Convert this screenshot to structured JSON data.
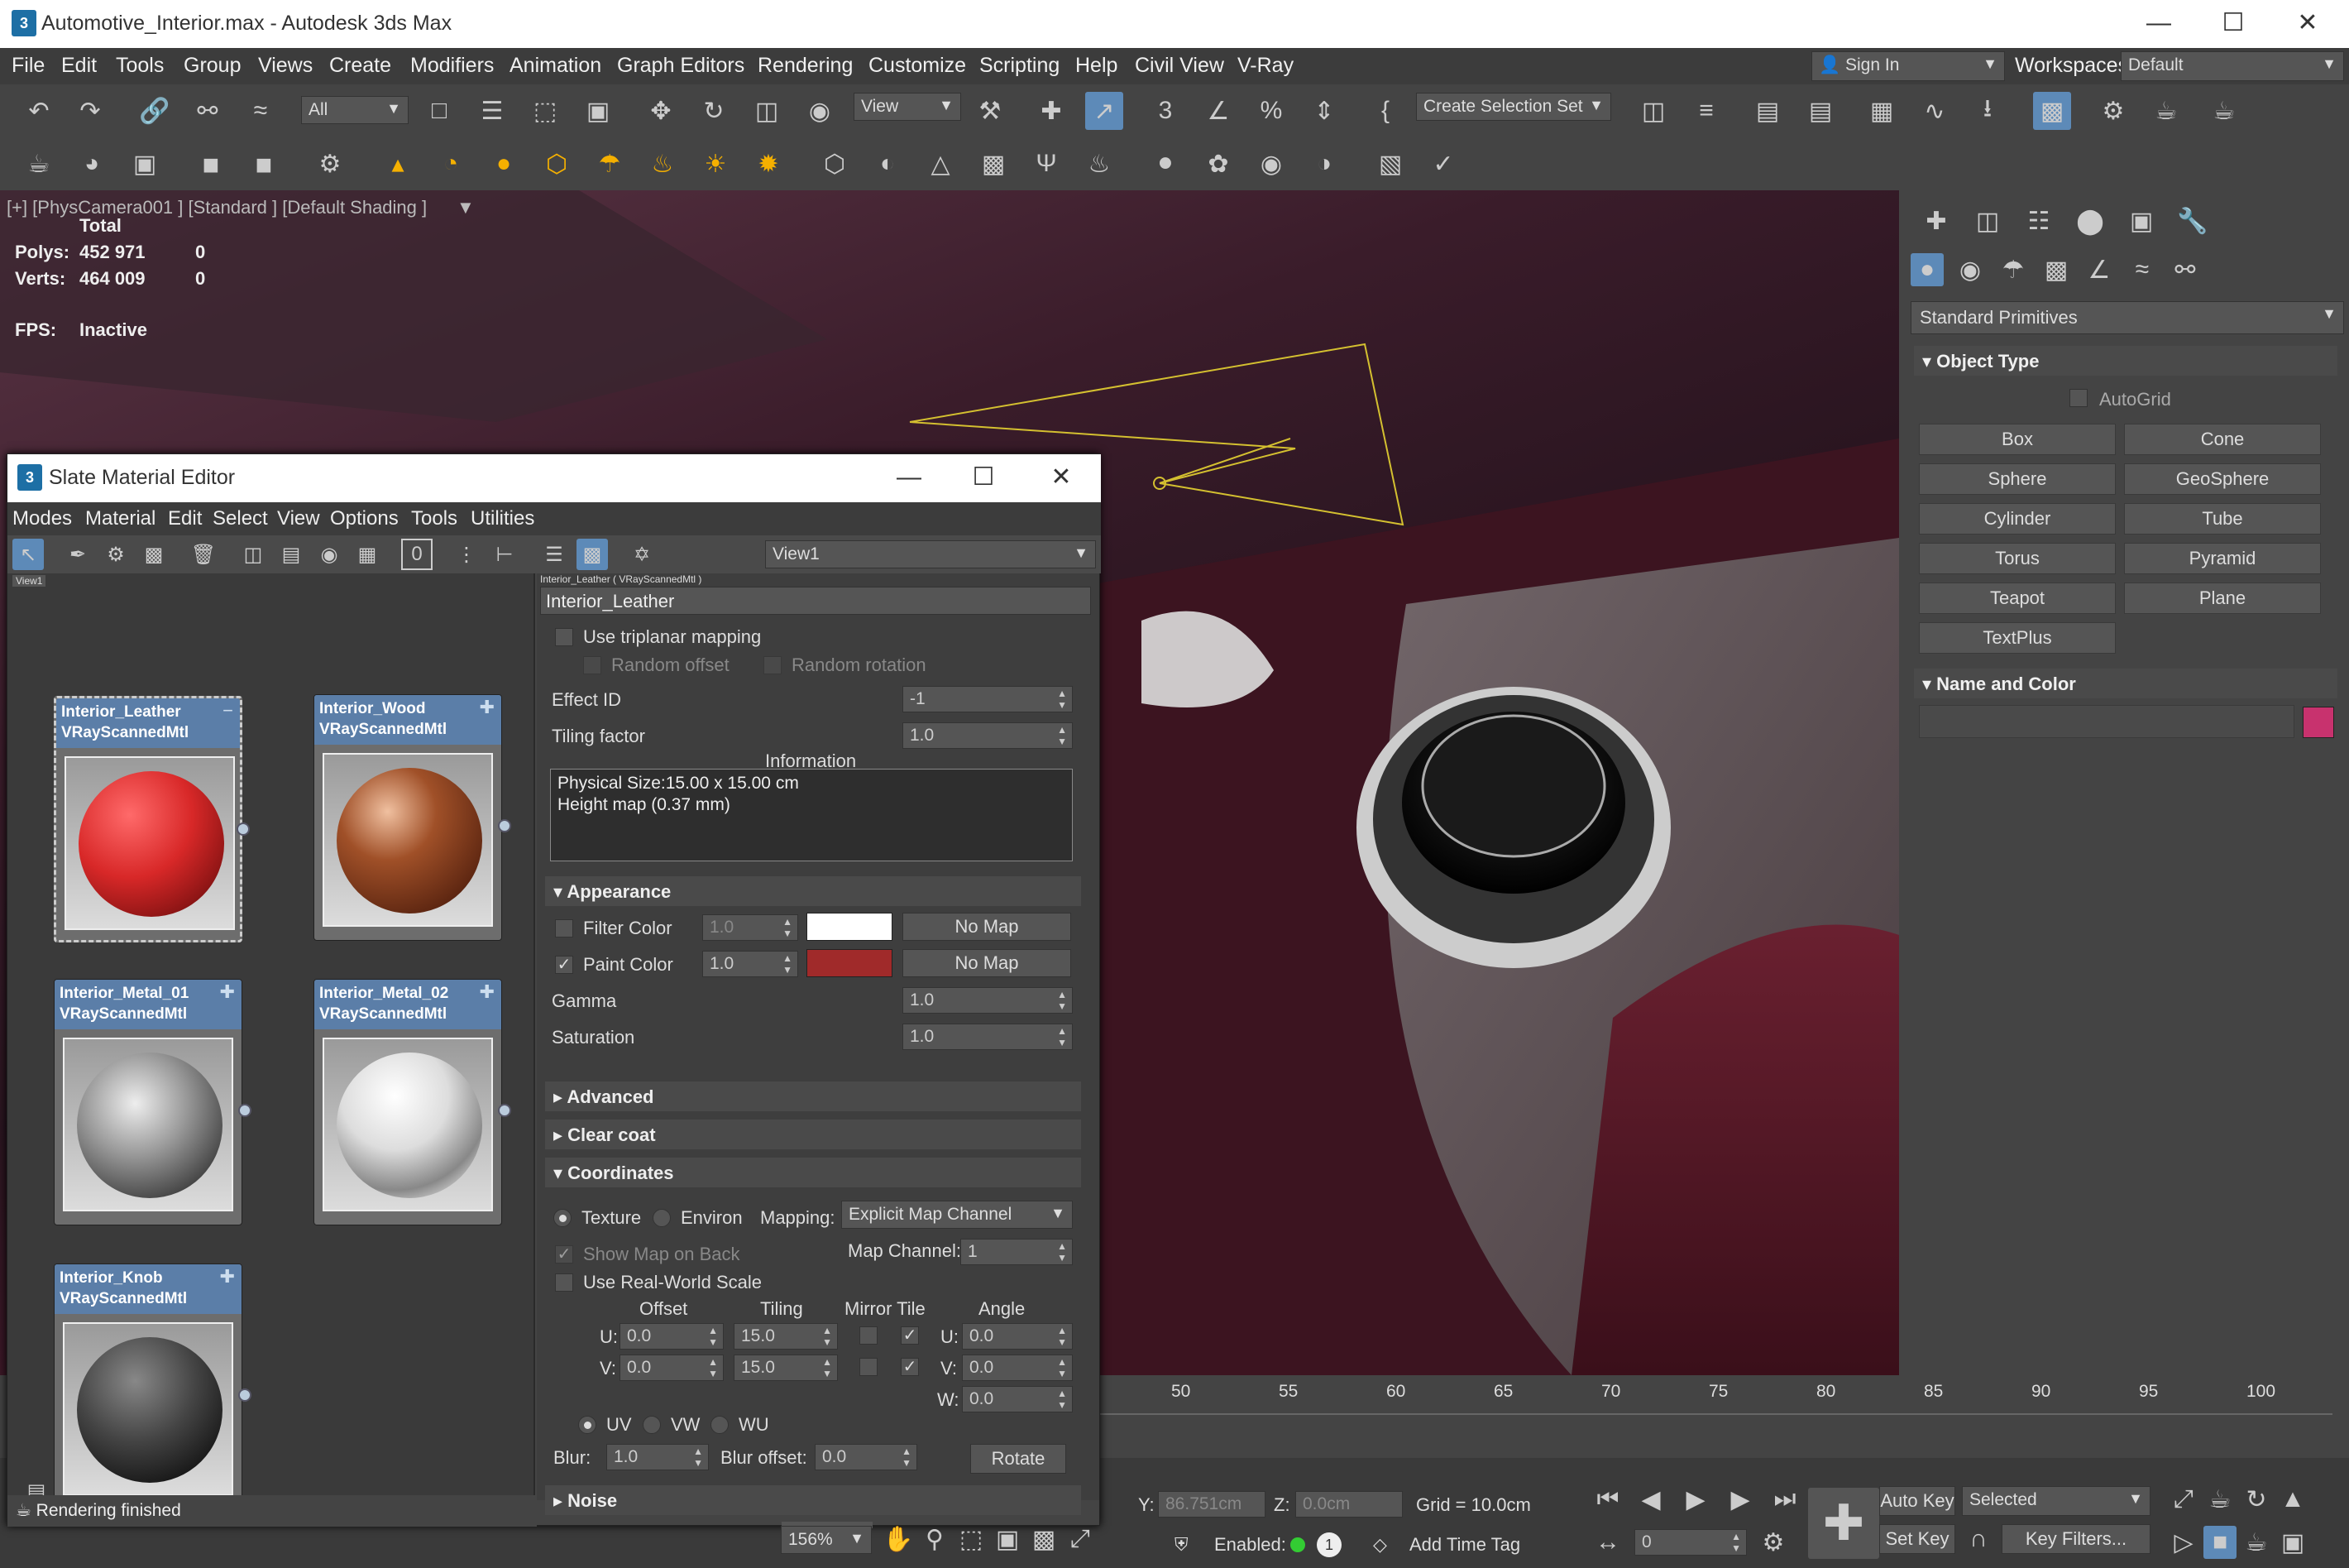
{
  "window": {
    "title": "Automotive_Interior.max - Autodesk 3ds Max",
    "app_icon": "3"
  },
  "menu": [
    "File",
    "Edit",
    "Tools",
    "Group",
    "Views",
    "Create",
    "Modifiers",
    "Animation",
    "Graph Editors",
    "Rendering",
    "Customize",
    "Scripting",
    "Help",
    "Civil View",
    "V-Ray"
  ],
  "signin": {
    "label": "Sign In",
    "workspaces_label": "Workspaces:",
    "workspace": "Default"
  },
  "toolbar": {
    "filter": "All",
    "refcoord": "View",
    "selection_set": "Create Selection Set"
  },
  "viewport": {
    "label": "[+] [PhysCamera001 ] [Standard ] [Default Shading ]",
    "stats_header": "Total",
    "polys_label": "Polys:",
    "polys": "452 971",
    "polys_sel": "0",
    "verts_label": "Verts:",
    "verts": "464 009",
    "verts_sel": "0",
    "fps_label": "FPS:",
    "fps": "Inactive"
  },
  "command_panel": {
    "category": "Standard Primitives",
    "object_type": "Object Type",
    "autogrid": "AutoGrid",
    "primitives": [
      "Box",
      "Cone",
      "Sphere",
      "GeoSphere",
      "Cylinder",
      "Tube",
      "Torus",
      "Pyramid",
      "Teapot",
      "Plane",
      "TextPlus"
    ],
    "name_and_color": "Name and Color",
    "color": "#c8326e"
  },
  "sme": {
    "title": "Slate Material Editor",
    "icon": "3",
    "menu": [
      "Modes",
      "Material",
      "Edit",
      "Select",
      "View",
      "Options",
      "Tools",
      "Utilities"
    ],
    "view_combo": "View1",
    "view_tab": "View1",
    "nodes": [
      {
        "name": "Interior_Leather",
        "type": "VRayScannedMtl"
      },
      {
        "name": "Interior_Wood",
        "type": "VRayScannedMtl"
      },
      {
        "name": "Interior_Metal_01",
        "type": "VRayScannedMtl"
      },
      {
        "name": "Interior_Metal_02",
        "type": "VRayScannedMtl"
      },
      {
        "name": "Interior_Knob",
        "type": "VRayScannedMtl"
      }
    ],
    "status": "Rendering finished",
    "zoom": "156%"
  },
  "props": {
    "header": "Interior_Leather  ( VRayScannedMtl )",
    "name": "Interior_Leather",
    "triplanar": "Use triplanar mapping",
    "random_offset": "Random offset",
    "random_rotation": "Random rotation",
    "effect_id_label": "Effect ID",
    "effect_id": "-1",
    "tiling_factor_label": "Tiling factor",
    "tiling_factor": "1.0",
    "information_label": "Information",
    "info_line1": "Physical Size:15.00 x 15.00 cm",
    "info_line2": "Height map (0.37 mm)",
    "appearance": "Appearance",
    "filter_color": "Filter Color",
    "filter_val": "1.0",
    "paint_color": "Paint Color",
    "paint_val": "1.0",
    "no_map": "No Map",
    "filter_swatch": "#ffffff",
    "paint_swatch": "#a02a2a",
    "gamma_label": "Gamma",
    "gamma": "1.0",
    "saturation_label": "Saturation",
    "saturation": "1.0",
    "advanced": "Advanced",
    "clear_coat": "Clear coat",
    "coordinates": "Coordinates",
    "texture": "Texture",
    "environ": "Environ",
    "mapping_label": "Mapping:",
    "mapping": "Explicit Map Channel",
    "show_map": "Show Map on Back",
    "map_channel_label": "Map Channel:",
    "map_channel": "1",
    "real_world": "Use Real-World Scale",
    "offset": "Offset",
    "tiling": "Tiling",
    "mirror_tile": "Mirror Tile",
    "angle": "Angle",
    "u_label": "U:",
    "v_label": "V:",
    "w_label": "W:",
    "u_offset": "0.0",
    "v_offset": "0.0",
    "u_tiling": "15.0",
    "v_tiling": "15.0",
    "u_angle": "0.0",
    "v_angle": "0.0",
    "w_angle": "0.0",
    "uv": "UV",
    "vw": "VW",
    "wu": "WU",
    "blur_label": "Blur:",
    "blur": "1.0",
    "blur_offset_label": "Blur offset:",
    "blur_offset": "0.0",
    "rotate": "Rotate",
    "noise": "Noise"
  },
  "timeline": {
    "ticks": [
      "50",
      "55",
      "60",
      "65",
      "70",
      "75",
      "80",
      "85",
      "90",
      "95",
      "100"
    ]
  },
  "status": {
    "y_label": "Y:",
    "y": "86.751cm",
    "z_label": "Z:",
    "z": "0.0cm",
    "grid": "Grid = 10.0cm",
    "enabled": "Enabled:",
    "add_time_tag": "Add Time Tag",
    "auto_key": "Auto Key",
    "selected": "Selected",
    "set_key": "Set Key",
    "key_filters": "Key Filters...",
    "frame": "0",
    "badge": "1"
  }
}
